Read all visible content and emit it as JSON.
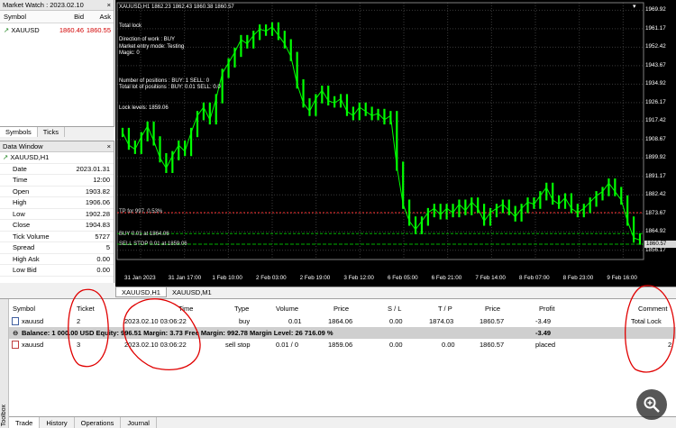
{
  "market_watch": {
    "title": "Market Watch : 2023.02.10",
    "close_label": "×",
    "col_symbol": "Symbol",
    "col_bid": "Bid",
    "col_ask": "Ask",
    "symbol": "XAUUSD",
    "bid": "1860.46",
    "ask": "1860.55",
    "tabs": [
      "Symbols",
      "Ticks"
    ]
  },
  "data_window": {
    "title": "Data Window",
    "close_label": "×",
    "symbol": "XAUUSD,H1",
    "rows": [
      {
        "label": "Date",
        "value": "2023.01.31"
      },
      {
        "label": "Time",
        "value": "12:00"
      },
      {
        "label": "Open",
        "value": "1903.82"
      },
      {
        "label": "High",
        "value": "1906.06"
      },
      {
        "label": "Low",
        "value": "1902.28"
      },
      {
        "label": "Close",
        "value": "1904.83"
      },
      {
        "label": "Tick Volume",
        "value": "5727"
      },
      {
        "label": "Spread",
        "value": "5"
      },
      {
        "label": "High Ask",
        "value": "0.00"
      },
      {
        "label": "Low Bid",
        "value": "0.00"
      }
    ]
  },
  "chart": {
    "header": "XAUUSD,H1   1862.23 1862.43 1860.38 1860.57",
    "lines": [
      "Total lock",
      "",
      "Direction of work : BUY",
      "Market entry mode: Testing",
      "Magic: 0",
      "",
      "",
      "",
      "Number of positions :  BUY: 1    SELL: 0",
      "Total lot of positions :  BUY: 0.01  SELL: 0.0",
      "",
      "",
      "Lock levels: 1859.06"
    ],
    "tp_label": "TP for 997, 0.53%",
    "buy_label": "BUY 0.01 at 1864.06",
    "sell_stop_label": "SELL STOP 0.01 at 1859.06",
    "current_price": "1860.57",
    "colors": {
      "background": "#000000",
      "candles": "#00ff00",
      "tp_line": "#ff3030",
      "buy_line": "#00b000",
      "sell_line": "#00b000",
      "price_box": "#d8d8d8"
    },
    "tabs": [
      "XAUUSD,H1",
      "XAUUSD,M1"
    ]
  },
  "chart_data": {
    "type": "line",
    "y_ticks": [
      "1969.92",
      "1961.17",
      "1952.42",
      "1943.67",
      "1934.92",
      "1926.17",
      "1917.42",
      "1908.67",
      "1899.92",
      "1891.17",
      "1882.42",
      "1873.67",
      "1864.92",
      "1856.17"
    ],
    "x_ticks": [
      "31 Jan 2023",
      "31 Jan 17:00",
      "1 Feb 10:00",
      "2 Feb 03:00",
      "2 Feb 19:00",
      "3 Feb 12:00",
      "6 Feb 05:00",
      "6 Feb 21:00",
      "7 Feb 14:00",
      "8 Feb 07:00",
      "8 Feb 23:00",
      "9 Feb 16:00"
    ],
    "ylim": [
      1851.8,
      1973.5
    ],
    "y": [
      1912,
      1906,
      1904,
      1910,
      1915,
      1908,
      1900,
      1895,
      1901,
      1906,
      1903,
      1912,
      1920,
      1924,
      1918,
      1928,
      1940,
      1945,
      1950,
      1956,
      1954,
      1958,
      1961,
      1960,
      1962,
      1958,
      1954,
      1948,
      1935,
      1926,
      1922,
      1928,
      1932,
      1927,
      1926,
      1928,
      1922,
      1920,
      1924,
      1922,
      1920,
      1921,
      1918,
      1920,
      1896,
      1878,
      1870,
      1866,
      1870,
      1874,
      1876,
      1873,
      1876,
      1874,
      1878,
      1875,
      1879,
      1876,
      1870,
      1874,
      1876,
      1878,
      1875,
      1872,
      1876,
      1879,
      1878,
      1882,
      1886,
      1880,
      1878,
      1881,
      1876,
      1874,
      1876,
      1879,
      1882,
      1884,
      1888,
      1884,
      1880,
      1870,
      1862,
      1861
    ]
  },
  "terminal": {
    "side_label": "Toolbox",
    "headers": [
      "Symbol",
      "Ticket",
      "Time",
      "Type",
      "Volume",
      "Price",
      "S / L",
      "T / P",
      "Price",
      "Profit",
      "Comment"
    ],
    "row1": {
      "symbol": "xauusd",
      "ticket": "2",
      "time": "2023.02.10 03:06:22",
      "type": "buy",
      "volume": "0.01",
      "price": "1864.06",
      "sl": "0.00",
      "tp": "1874.03",
      "cur_price": "1860.57",
      "profit": "-3.49",
      "comment": "Total Lock"
    },
    "balance": {
      "text": "Balance: 1 000.00 USD  Equity: 996.51  Margin: 3.73  Free Margin: 992.78  Margin Level: 26 716.09 %",
      "profit": "-3.49"
    },
    "row2": {
      "symbol": "xauusd",
      "ticket": "3",
      "time": "2023.02.10 03:06:22",
      "type": "sell stop",
      "volume": "0.01 / 0",
      "price": "1859.06",
      "sl": "0.00",
      "tp": "0.00",
      "cur_price": "1860.57",
      "profit": "placed",
      "comment": "2"
    },
    "tabs": [
      "Trade",
      "History",
      "Operations",
      "Journal"
    ]
  }
}
